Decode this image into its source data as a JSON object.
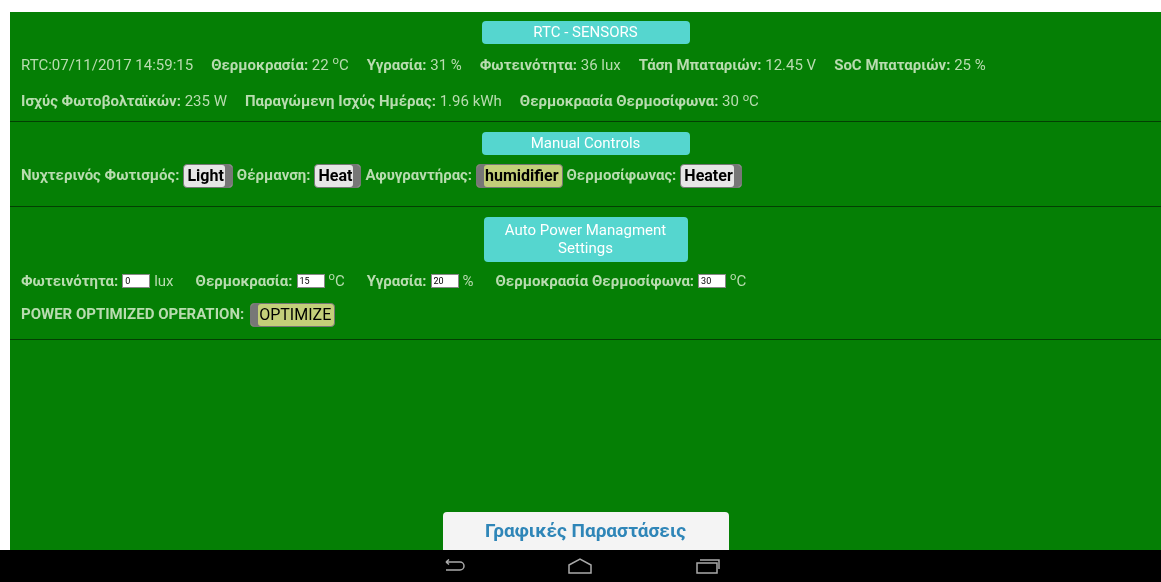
{
  "sensors": {
    "title": "RTC - SENSORS",
    "readings": [
      "RTC:07/11/2017 14:59:15",
      "**Θερμοκρασία:** 22 $^{o}$C",
      "**Υγρασία:** 31 %",
      "**Φωτεινότητα:** 36 lux",
      "**Τάση Μπαταριών:** 12.45 V",
      "**SoC Μπαταριών:** 25 %",
      "**Ισχύς Φωτοβολταϊκών:** 235 W",
      "**Παραγώμενη Ισχύς Ημέρας:** 1.96 kWh",
      "**Θερμοκρασία Θερμοσίφωνα:** 30 $^{o}$C"
    ]
  },
  "manual": {
    "title": "Manual Controls",
    "controls": [
      {
        "label": "Νυχτερινός Φωτισμός:",
        "toggle": "Light",
        "on": false
      },
      {
        "label": "Θέρμανση:",
        "toggle": "Heat",
        "on": false
      },
      {
        "label": "Αφυγραντήρας:",
        "toggle": "humidifier",
        "on": true
      },
      {
        "label": "Θερμοσίφωνας:",
        "toggle": "Heater",
        "on": false
      }
    ]
  },
  "auto": {
    "title": "Auto Power Managment Settings",
    "settings": [
      {
        "label": "Φωτεινότητα:",
        "value": "0",
        "unit": "lux"
      },
      {
        "label": "Θερμοκρασία:",
        "value": "15",
        "unit": "$^{o}$C"
      },
      {
        "label": "Υγρασία:",
        "value": "20",
        "unit": "%"
      },
      {
        "label": "Θερμοκρασία Θερμοσίφωνα:",
        "value": "30",
        "unit": "$^{o}$C"
      }
    ],
    "optimize": {
      "label": "POWER OPTIMIZED OPERATION:",
      "toggle": "OPTIMIZE",
      "on": true
    }
  },
  "charts_button": "Γραφικές Παραστάσεις"
}
